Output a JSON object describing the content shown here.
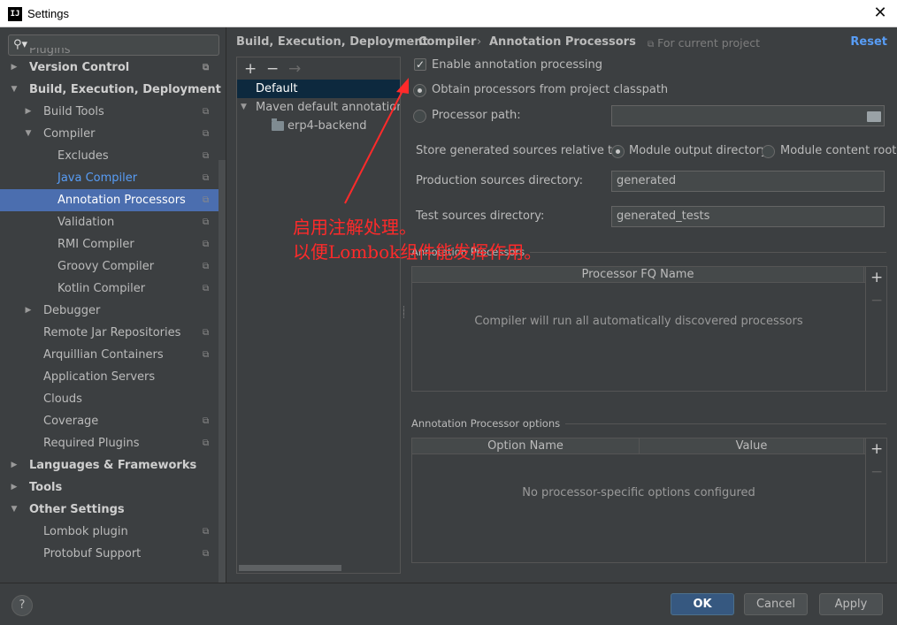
{
  "window": {
    "title": "Settings",
    "app_icon": "IJ"
  },
  "sidebar": {
    "search_placeholder": "",
    "partial_top_item": "Plugins",
    "items": [
      {
        "label": "Version Control",
        "level": 0,
        "expanded": false,
        "bold": true,
        "project": true
      },
      {
        "label": "Build, Execution, Deployment",
        "level": 0,
        "expanded": true,
        "bold": true,
        "project": false
      },
      {
        "label": "Build Tools",
        "level": 1,
        "expanded": false,
        "project": true
      },
      {
        "label": "Compiler",
        "level": 1,
        "expanded": true,
        "project": true
      },
      {
        "label": "Excludes",
        "level": 2,
        "project": true
      },
      {
        "label": "Java Compiler",
        "level": 2,
        "project": true,
        "link": true
      },
      {
        "label": "Annotation Processors",
        "level": 2,
        "project": true,
        "selected": true
      },
      {
        "label": "Validation",
        "level": 2,
        "project": true
      },
      {
        "label": "RMI Compiler",
        "level": 2,
        "project": true
      },
      {
        "label": "Groovy Compiler",
        "level": 2,
        "project": true
      },
      {
        "label": "Kotlin Compiler",
        "level": 2,
        "project": true
      },
      {
        "label": "Debugger",
        "level": 1,
        "expanded": false,
        "project": false
      },
      {
        "label": "Remote Jar Repositories",
        "level": 1,
        "project": true
      },
      {
        "label": "Arquillian Containers",
        "level": 1,
        "project": true
      },
      {
        "label": "Application Servers",
        "level": 1,
        "project": false
      },
      {
        "label": "Clouds",
        "level": 1,
        "project": false
      },
      {
        "label": "Coverage",
        "level": 1,
        "project": true
      },
      {
        "label": "Required Plugins",
        "level": 1,
        "project": true
      },
      {
        "label": "Languages & Frameworks",
        "level": 0,
        "expanded": false,
        "bold": true,
        "project": false
      },
      {
        "label": "Tools",
        "level": 0,
        "expanded": false,
        "bold": true,
        "project": false
      },
      {
        "label": "Other Settings",
        "level": 0,
        "expanded": true,
        "bold": true,
        "project": false
      },
      {
        "label": "Lombok plugin",
        "level": 1,
        "project": true
      },
      {
        "label": "Protobuf Support",
        "level": 1,
        "project": true
      }
    ]
  },
  "header": {
    "breadcrumbs": [
      "Build, Execution, Deployment",
      "Compiler",
      "Annotation Processors"
    ],
    "for_project": "For current project",
    "reset": "Reset"
  },
  "profiles": {
    "toolbar": {
      "add": "+",
      "remove": "−",
      "move": "→"
    },
    "default": "Default",
    "group": "Maven default annotation processors profile",
    "module": "erp4-backend"
  },
  "form": {
    "enable_label": "Enable annotation processing",
    "enable_checked": true,
    "obtain_label": "Obtain processors from project classpath",
    "processor_path_label": "Processor path:",
    "processor_path_value": "",
    "store_label": "Store generated sources relative to:",
    "module_output_label": "Module output directory",
    "module_content_label": "Module content root",
    "production_label": "Production sources directory:",
    "production_value": "generated",
    "test_label": "Test sources directory:",
    "test_value": "generated_tests"
  },
  "processors_section": {
    "title": "Annotation Processors",
    "column": "Processor FQ Name",
    "empty": "Compiler will run all automatically discovered processors"
  },
  "options_section": {
    "title": "Annotation Processor options",
    "columns": [
      "Option Name",
      "Value"
    ],
    "empty": "No processor-specific options configured"
  },
  "annotation": {
    "line1": "启用注解处理。",
    "line2": "以便Lombok组件能发挥作用。",
    "color": "#ff2a2a"
  },
  "footer": {
    "help": "?",
    "ok": "OK",
    "cancel": "Cancel",
    "apply": "Apply"
  }
}
